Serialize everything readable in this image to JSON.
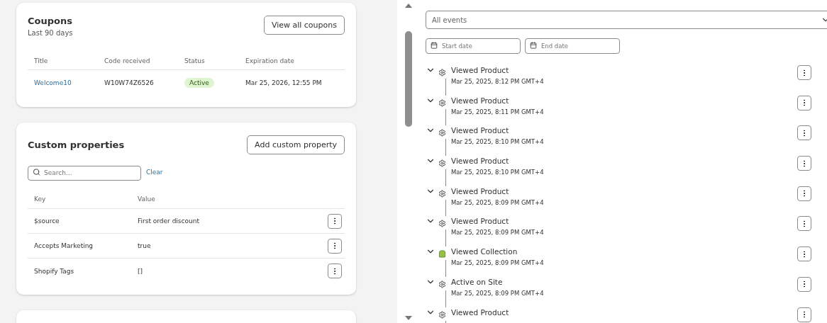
{
  "coupons": {
    "title": "Coupons",
    "subtitle": "Last 90 days",
    "button": "View all coupons",
    "columns": [
      "Title",
      "Code received",
      "Status",
      "Expiration date"
    ],
    "rows": [
      {
        "title": "Welcome10",
        "code": "W10W74Z6526",
        "status": "Active",
        "expiration": "Mar 25, 2026, 12:55 PM"
      }
    ]
  },
  "custom_properties": {
    "title": "Custom properties",
    "button": "Add custom property",
    "search": {
      "placeholder": "Search..."
    },
    "clear": "Clear",
    "columns": [
      "Key",
      "Value"
    ],
    "rows": [
      {
        "key": "$source",
        "value": "First order discount"
      },
      {
        "key": "Accepts Marketing",
        "value": "true"
      },
      {
        "key": "Shopify Tags",
        "value": "[]"
      }
    ]
  },
  "filters": {
    "event_select": "All events",
    "start_date": {
      "placeholder": "Start date"
    },
    "end_date": {
      "placeholder": "End date"
    }
  },
  "events": [
    {
      "kind": "gear",
      "title": "Viewed Product",
      "time": "Mar 25, 2025, 8:12 PM GMT+4"
    },
    {
      "kind": "gear",
      "title": "Viewed Product",
      "time": "Mar 25, 2025, 8:11 PM GMT+4"
    },
    {
      "kind": "gear",
      "title": "Viewed Product",
      "time": "Mar 25, 2025, 8:10 PM GMT+4"
    },
    {
      "kind": "gear",
      "title": "Viewed Product",
      "time": "Mar 25, 2025, 8:10 PM GMT+4"
    },
    {
      "kind": "gear",
      "title": "Viewed Product",
      "time": "Mar 25, 2025, 8:09 PM GMT+4"
    },
    {
      "kind": "gear",
      "title": "Viewed Product",
      "time": "Mar 25, 2025, 8:09 PM GMT+4"
    },
    {
      "kind": "shop",
      "title": "Viewed Collection",
      "time": "Mar 25, 2025, 8:09 PM GMT+4"
    },
    {
      "kind": "gear",
      "title": "Active on Site",
      "time": "Mar 25, 2025, 8:09 PM GMT+4"
    },
    {
      "kind": "gear",
      "title": "Viewed Product"
    }
  ]
}
